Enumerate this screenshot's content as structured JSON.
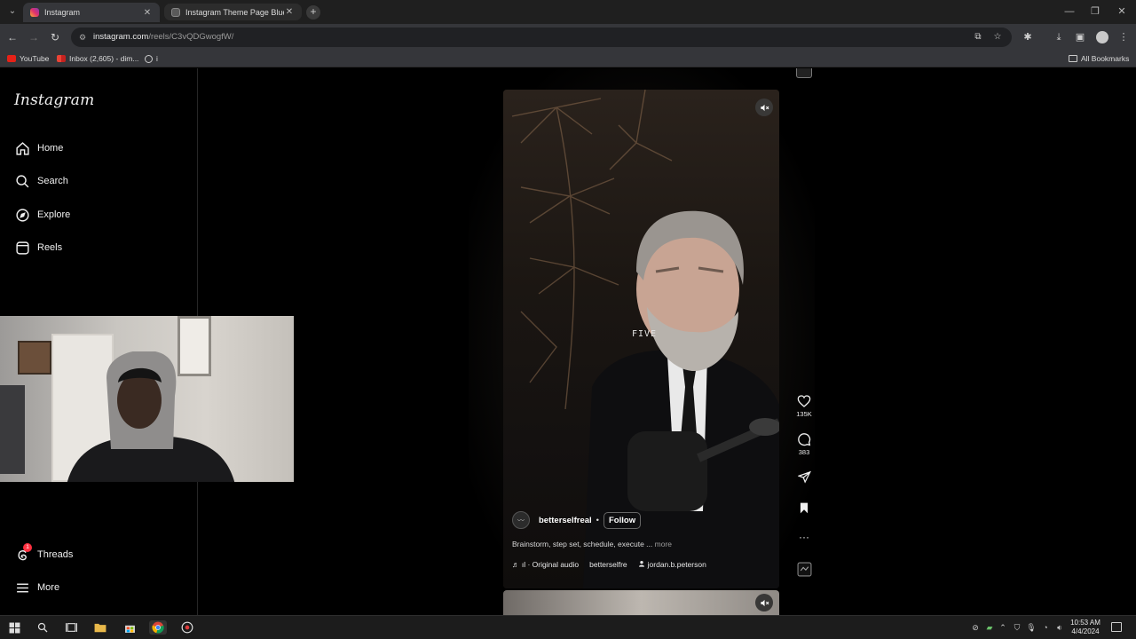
{
  "browser": {
    "tabs": [
      {
        "title": "Instagram",
        "active": true
      },
      {
        "title": "Instagram Theme Page Blueprint",
        "active": false
      }
    ],
    "url_host": "instagram.com",
    "url_path": "/reels/C3vQDGwogfW/",
    "bookmarks": [
      {
        "label": "YouTube",
        "icon": "youtube-icon"
      },
      {
        "label": "Inbox (2,605) - dim...",
        "icon": "gmail-icon"
      },
      {
        "label": "i",
        "icon": "globe-icon"
      }
    ],
    "all_bookmarks_label": "All Bookmarks"
  },
  "instagram": {
    "logo": "Instagram",
    "nav": [
      {
        "label": "Home",
        "icon": "home-icon"
      },
      {
        "label": "Search",
        "icon": "search-icon"
      },
      {
        "label": "Explore",
        "icon": "compass-icon"
      },
      {
        "label": "Reels",
        "icon": "reels-icon"
      }
    ],
    "nav_bottom": [
      {
        "label": "Threads",
        "icon": "threads-icon",
        "badge": "1"
      },
      {
        "label": "More",
        "icon": "menu-icon"
      }
    ]
  },
  "reel": {
    "overlay_text": "FIVE",
    "username": "betterselfreal",
    "separator": "•",
    "follow_label": "Follow",
    "caption": "Brainstorm, step set, schedule, execute ...",
    "caption_more": "more",
    "audio_label": "♬ ıl · Original audio",
    "audio_user": "betterselfre",
    "tagged_user": "jordan.b.peterson",
    "likes": "135K",
    "comments": "383"
  },
  "taskbar": {
    "time": "10:53 AM",
    "date": "4/4/2024"
  },
  "colors": {
    "chrome_dark": "#1f1f1f",
    "toolbar": "#35363a",
    "ig_background": "#000000",
    "badge_red": "#ff3040"
  }
}
